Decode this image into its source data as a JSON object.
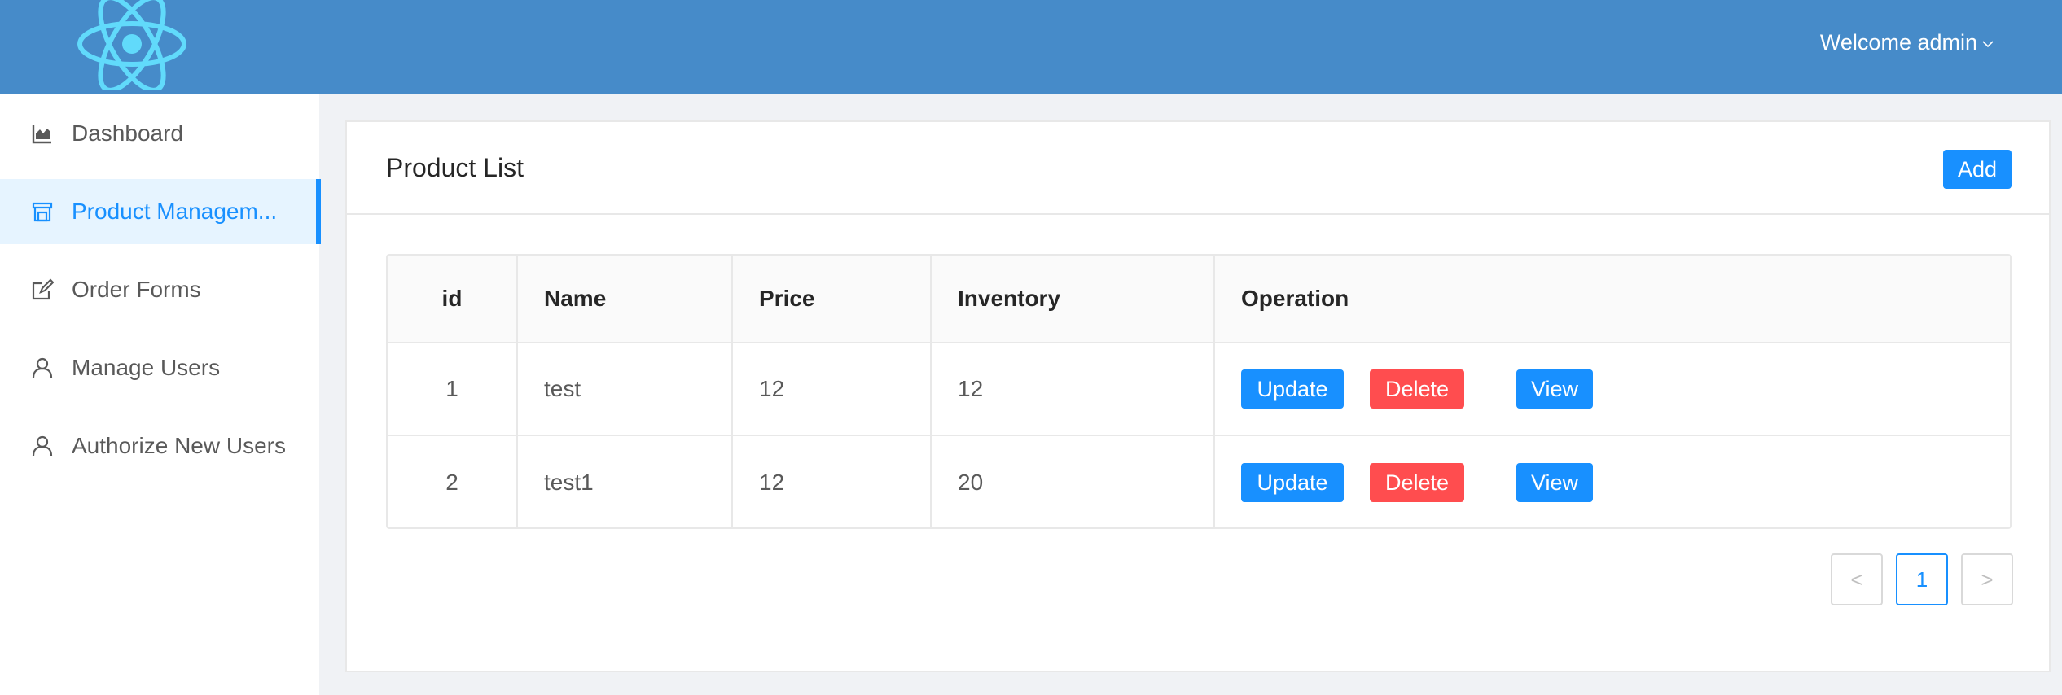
{
  "header": {
    "welcome_text": "Welcome admin",
    "brand_color": "#468bc9",
    "logo_icon": "react-atom-logo"
  },
  "sidebar": {
    "items": [
      {
        "label": "Dashboard",
        "icon": "area-chart-icon",
        "active": false
      },
      {
        "label": "Product Managem...",
        "icon": "shop-icon",
        "active": true
      },
      {
        "label": "Order Forms",
        "icon": "form-edit-icon",
        "active": false
      },
      {
        "label": "Manage Users",
        "icon": "user-icon",
        "active": false
      },
      {
        "label": "Authorize New Users",
        "icon": "user-icon",
        "active": false
      }
    ]
  },
  "card": {
    "title": "Product List",
    "add_label": "Add"
  },
  "table": {
    "columns": [
      "id",
      "Name",
      "Price",
      "Inventory",
      "Operation"
    ],
    "rows": [
      {
        "id": "1",
        "name": "test",
        "price": "12",
        "inventory": "12"
      },
      {
        "id": "2",
        "name": "test1",
        "price": "12",
        "inventory": "20"
      }
    ],
    "actions": {
      "update": "Update",
      "delete": "Delete",
      "view": "View"
    }
  },
  "pagination": {
    "prev": "<",
    "current_page": "1",
    "next": ">"
  },
  "colors": {
    "primary": "#1890ff",
    "danger": "#ff4d4f",
    "active_bg": "#e6f4ff"
  }
}
